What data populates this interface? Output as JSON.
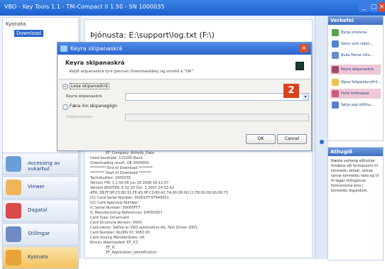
{
  "window": {
    "title": "VBO - Key Tools 1.1 - TM-Compact II 1.50 - SN 1000035"
  },
  "tree": {
    "root": "Kyonata",
    "child": "Download"
  },
  "nav": [
    {
      "label": "Avcessing av vukarbul",
      "icon": "clock-icon"
    },
    {
      "label": "Viewer",
      "icon": "person-icon"
    },
    {
      "label": "Dagatal",
      "icon": "calendar-icon"
    },
    {
      "label": "Stillingar",
      "icon": "gear-icon"
    },
    {
      "label": "Kyonata",
      "icon": "clock-icon"
    }
  ],
  "log": {
    "path": "Þjónusta: E:\\support\\log.txt   (F:\\)",
    "lines": [
      "EF_Company_Activity_Data",
      "Used baudrate: 115200 Baud",
      "Downloading result: OK 0000000",
      "********* End of Download ********",
      "******** Start of Download *******",
      "Tachobuilder: 1000035",
      "Version FW: 1.1.50.06 Jun 18 2008 16:11:07",
      "Version BOOTER: E.02.03 Oct. 1 2007 14:52:42",
      "ATR: 3B:FF:9F:C0:80:31:FE:45:9F:C0:80:42:7A:00:06:00:11:F8:00:00:00:00:73",
      "ICC Card Serial Number: 00001FF:97940001",
      "ICC Card Approval Number:",
      "IC Serial Number: 00000FF7",
      "IC Manufacturing References: D4050307",
      "Card Type: Drivercard",
      "Card Structure Version: 0000",
      "Card owner: Sethel er VDO automotive AG, Test Driver 2003",
      "Card Number: NLDRV 01 3063 00",
      "Card Issuing MemberState: UK",
      "Blocks downloaded: EF_ICC",
      "EF_IC",
      "EF_Application_Identification"
    ]
  },
  "tasks": {
    "header": "Verkefni",
    "items": [
      {
        "label": "Byrja umsluna",
        "highlight": false
      },
      {
        "label": "Setur sam sidan...",
        "highlight": false
      },
      {
        "label": "Buka fleirar villu...",
        "highlight": false
      },
      {
        "label": "Keyra skipanaskrá",
        "highlight": true
      },
      {
        "label": "Opna Sólganduryfirli...",
        "highlight": false
      },
      {
        "label": "Ferla fetitmaver",
        "highlight": true
      },
      {
        "label": "Setja upp stillinu...",
        "highlight": false
      }
    ]
  },
  "info": {
    "header": "Athugið",
    "text": "Næsta verkeng aðilutúar hindana við fyrirspunrni til kinmeldu skráár, selnar tarnar kinmeldu nara og til til tegar sillingarvar, formursluna eins | kinmeldu tegundum."
  },
  "dialog": {
    "title": "Keyra skipanaskrá",
    "heading": "Keyra skipanaskrá",
    "subtitle": "Veljið skipanaskrá fyrir þennan Downloadsbey og smelld á \"OK\".",
    "option1": "Lesa skipanaskrá",
    "field1_label": "Keyra skipanaskrá",
    "option2": "Færa inn skipanagögn",
    "field2_label": "Skipanadagar",
    "ok": "OK",
    "cancel": "Cancel"
  },
  "badge": "2"
}
